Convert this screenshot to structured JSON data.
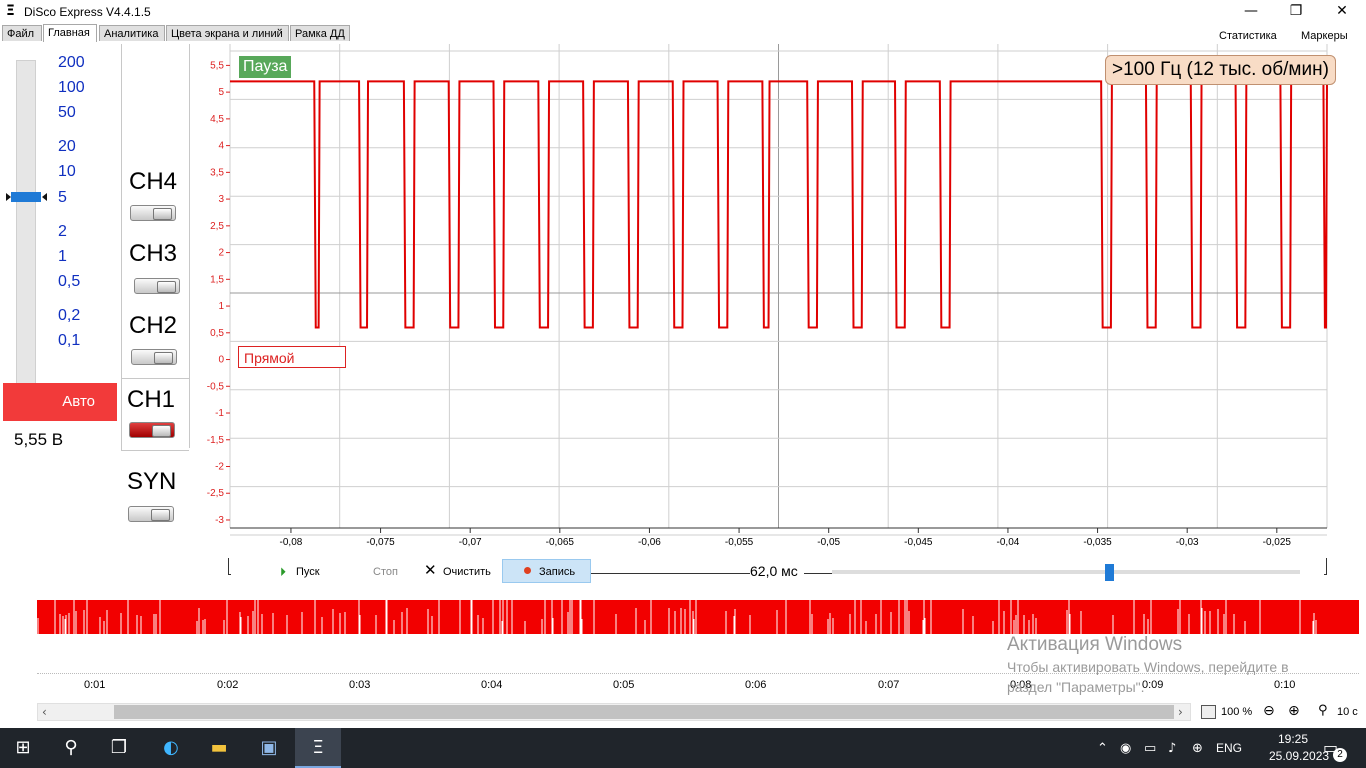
{
  "window": {
    "title": "DiSco Express V4.4.1.5",
    "app_icon": "Ξ",
    "minimize": "—",
    "maximize": "❐",
    "close": "✕"
  },
  "tabs": [
    {
      "label": "Файл"
    },
    {
      "label": "Главная"
    },
    {
      "label": "Аналитика"
    },
    {
      "label": "Цвета экрана и линий"
    },
    {
      "label": "Рамка ДД"
    }
  ],
  "top_links": {
    "stats": "Статистика",
    "markers": "Маркеры"
  },
  "scale": {
    "labels": [
      "200",
      "100",
      "50",
      "20",
      "10",
      "5",
      "2",
      "1",
      "0,5",
      "0,2",
      "0,1"
    ],
    "selected": "5",
    "auto": "Авто",
    "voltage": "5,55 В"
  },
  "channels": [
    {
      "label": "CH4",
      "on": false
    },
    {
      "label": "CH3",
      "on": false
    },
    {
      "label": "CH2",
      "on": false
    },
    {
      "label": "CH1",
      "on": true
    },
    {
      "label": "SYN",
      "on": false
    }
  ],
  "scope": {
    "pause": "Пауза",
    "frequency": ">100 Гц (12 тыс. об/мин)",
    "mode": "Прямой",
    "y_ticks": [
      "5,5",
      "5",
      "4,5",
      "4",
      "3,5",
      "3",
      "2,5",
      "2",
      "1,5",
      "1",
      "0,5",
      "0",
      "-0,5",
      "-1",
      "-1,5",
      "-2",
      "-2,5",
      "-3"
    ],
    "x_ticks": [
      "-0,08",
      "-0,075",
      "-0,07",
      "-0,065",
      "-0,06",
      "-0,055",
      "-0,05",
      "-0,045",
      "-0,04",
      "-0,035",
      "-0,03",
      "-0,025"
    ]
  },
  "chart_data": {
    "type": "line",
    "xlabel": "",
    "ylabel": "",
    "xlim": [
      -0.0834,
      -0.0222
    ],
    "ylim": [
      -3.15,
      5.9
    ],
    "high": 5.2,
    "low": 0.6,
    "pulses": [
      [
        -0.0787,
        -0.0784
      ],
      [
        -0.0762,
        -0.0757
      ],
      [
        -0.0737,
        -0.0731
      ],
      [
        -0.0712,
        -0.0706
      ],
      [
        -0.0687,
        -0.0681
      ],
      [
        -0.0662,
        -0.0656
      ],
      [
        -0.0637,
        -0.0631
      ],
      [
        -0.0612,
        -0.0606
      ],
      [
        -0.0587,
        -0.0581
      ],
      [
        -0.0562,
        -0.0556
      ],
      [
        -0.0537,
        -0.0533
      ],
      [
        -0.0512,
        -0.0506
      ],
      [
        -0.0487,
        -0.0481
      ],
      [
        -0.0463,
        -0.0457
      ],
      [
        -0.0438,
        -0.0432
      ],
      [
        -0.0348,
        -0.0342
      ],
      [
        -0.0323,
        -0.0317
      ],
      [
        -0.0298,
        -0.0292
      ],
      [
        -0.0273,
        -0.0267
      ],
      [
        -0.0248,
        -0.0242
      ],
      [
        -0.0224,
        -0.0222
      ]
    ],
    "color": "#e00000"
  },
  "controls": {
    "start": "Пуск",
    "stop": "Стоп",
    "clear": "Очистить",
    "record": "Запись",
    "time_window": "62,0 мс"
  },
  "overview": {
    "time_labels": [
      "0:01",
      "0:02",
      "0:03",
      "0:04",
      "0:05",
      "0:06",
      "0:07",
      "0:08",
      "0:09",
      "0:10"
    ]
  },
  "watermark": {
    "line1": "Активация Windows",
    "line2": "Чтобы активировать Windows, перейдите в раздел \"Параметры\"."
  },
  "statusbar": {
    "zoom": "100 %",
    "window": "10 с"
  },
  "taskbar": {
    "time": "19:25",
    "date": "25.09.2023",
    "lang": "ENG",
    "notifications": "2"
  }
}
